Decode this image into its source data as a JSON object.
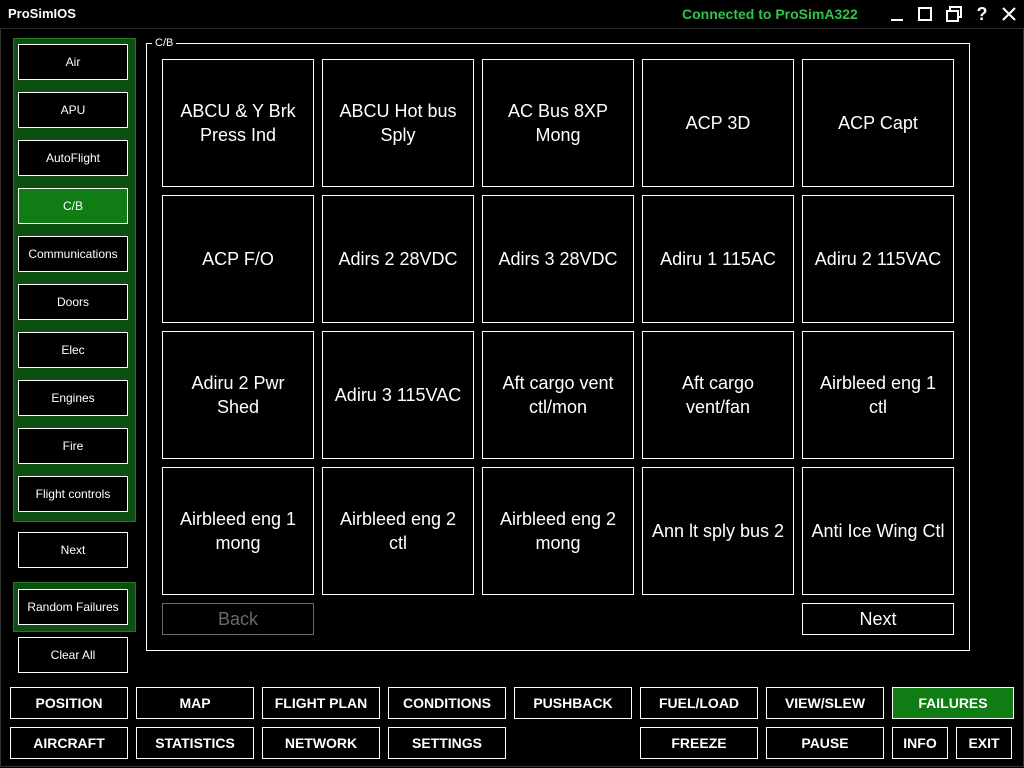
{
  "window": {
    "title": "ProSimIOS",
    "connection_status": "Connected to ProSimA322",
    "status_color": "#33c24a",
    "controls": [
      "minimize-icon",
      "maximize-icon",
      "restore-icon",
      "help-icon",
      "close-icon"
    ]
  },
  "sidebar": {
    "categories": [
      {
        "label": "Air",
        "active": false
      },
      {
        "label": "APU",
        "active": false
      },
      {
        "label": "AutoFlight",
        "active": false
      },
      {
        "label": "C/B",
        "active": true
      },
      {
        "label": "Communications",
        "active": false
      },
      {
        "label": "Doors",
        "active": false
      },
      {
        "label": "Elec",
        "active": false
      },
      {
        "label": "Engines",
        "active": false
      },
      {
        "label": "Fire",
        "active": false
      },
      {
        "label": "Flight controls",
        "active": false
      }
    ],
    "next_label": "Next",
    "random_failures_label": "Random Failures",
    "clear_all_label": "Clear All"
  },
  "panel": {
    "title": "C/B",
    "items": [
      "ABCU & Y Brk Press Ind",
      "ABCU Hot bus Sply",
      "AC Bus 8XP Mong",
      "ACP 3D",
      "ACP Capt",
      "ACP F/O",
      "Adirs 2 28VDC",
      "Adirs 3 28VDC",
      "Adiru 1 115AC",
      "Adiru 2 115VAC",
      "Adiru 2 Pwr Shed",
      "Adiru 3 115VAC",
      "Aft cargo vent ctl/mon",
      "Aft cargo vent/fan",
      "Airbleed eng 1 ctl",
      "Airbleed eng 1 mong",
      "Airbleed eng 2 ctl",
      "Airbleed eng 2 mong",
      "Ann lt sply bus 2",
      "Anti Ice Wing Ctl"
    ],
    "back_label": "Back",
    "next_label": "Next"
  },
  "bottom_nav": {
    "row1": [
      {
        "label": "POSITION",
        "active": false
      },
      {
        "label": "MAP",
        "active": false
      },
      {
        "label": "FLIGHT PLAN",
        "active": false
      },
      {
        "label": "CONDITIONS",
        "active": false
      },
      {
        "label": "PUSHBACK",
        "active": false
      },
      {
        "label": "FUEL/LOAD",
        "active": false
      },
      {
        "label": "VIEW/SLEW",
        "active": false
      },
      {
        "label": "FAILURES",
        "active": true
      }
    ],
    "row2": [
      {
        "label": "AIRCRAFT",
        "active": false
      },
      {
        "label": "STATISTICS",
        "active": false
      },
      {
        "label": "NETWORK",
        "active": false
      },
      {
        "label": "SETTINGS",
        "active": false
      },
      {
        "label": "FREEZE",
        "active": false
      },
      {
        "label": "PAUSE",
        "active": false
      },
      {
        "label": "INFO",
        "active": false
      },
      {
        "label": "EXIT",
        "active": false
      }
    ]
  },
  "colors": {
    "active_green": "#0f7d14",
    "group_green": "#0d4f10",
    "border": "#ffffff",
    "disabled": "#6a6a6a"
  }
}
